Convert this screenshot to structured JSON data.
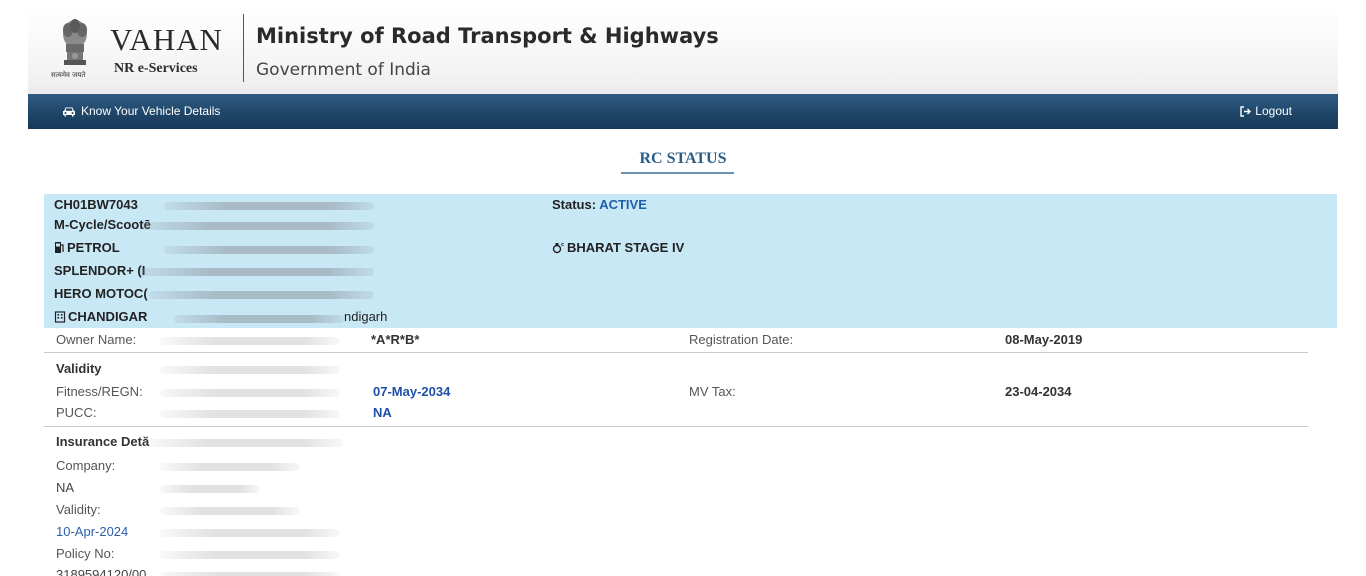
{
  "header": {
    "emblem_caption": "सत्यमेव जयते",
    "brand_vahan": "VAHAN",
    "brand_sub": "NR e-Services",
    "ministry": "Ministry of Road Transport & Highways",
    "government": "Government of India"
  },
  "nav": {
    "know_vehicle": "Know Your Vehicle Details",
    "logout": "Logout"
  },
  "title": "RC STATUS",
  "summary": {
    "reg_no": "CH01BW7043",
    "vehicle_class": "M-Cycle/Scootē",
    "fuel": "PETROL",
    "model": "SPLENDOR+ (I",
    "maker": "HERO MOTOC(",
    "rto_start": "CHANDIGAR",
    "rto_end": "ndigarh",
    "status_label": "Status:",
    "status_value": "ACTIVE",
    "emission_norm": "BHARAT STAGE IV"
  },
  "owner": {
    "label": "Owner Name:",
    "value": "*A*R*B*",
    "reg_date_label": "Registration Date:",
    "reg_date_value": "08-May-2019"
  },
  "validity": {
    "heading": "Validity",
    "fitness_label": "Fitness/REGN:",
    "fitness_value": "07-May-2034",
    "mvtax_label": "MV Tax:",
    "mvtax_value": "23-04-2034",
    "pucc_label": "PUCC:",
    "pucc_value": "NA"
  },
  "insurance": {
    "heading": "Insurance Detă",
    "company_label": "Company:",
    "company_value": "NA",
    "validity_label": "Validity:",
    "validity_value": "10-Apr-2024",
    "policy_label": "Policy No:",
    "policy_value": "3189594120/00"
  },
  "colors": {
    "nav_bg": "#1f4669",
    "summary_bg": "#c9e8f6",
    "accent_blue": "#1f5fa6",
    "title_blue": "#2b5d86"
  }
}
